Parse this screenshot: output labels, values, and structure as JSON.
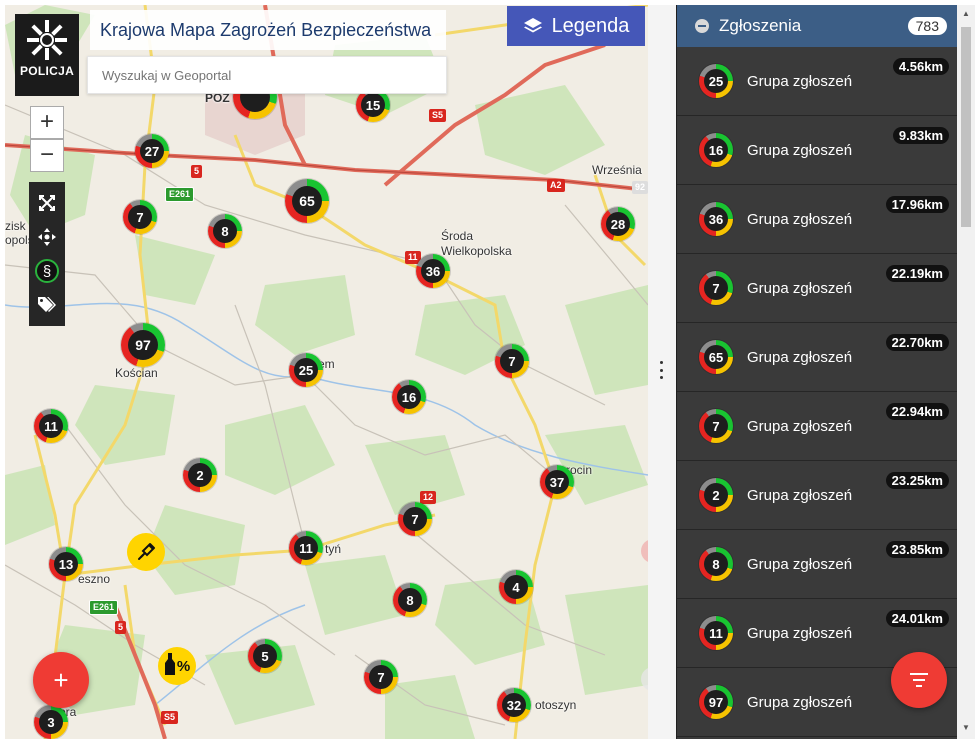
{
  "header": {
    "logo_text": "POLICJA",
    "title_part1": "Krajowa Mapa ",
    "title_part2": "Zagrożeń Bezpieczeństwa",
    "search_placeholder": "Wyszukaj w Geoportal",
    "legend_label": "Legenda"
  },
  "map_controls": {
    "zoom_in": "+",
    "zoom_out": "−",
    "tools": [
      "fullscreen-icon",
      "locate-icon",
      "paragraph-icon",
      "tags-icon"
    ],
    "paragraph_glyph": "§",
    "add_button": "+"
  },
  "places": [
    {
      "id": "poz",
      "label": "POZ"
    },
    {
      "id": "wrzesnia",
      "label": "Września"
    },
    {
      "id": "srem",
      "label": "em"
    },
    {
      "id": "sroda1",
      "label": "Środa"
    },
    {
      "id": "sroda2",
      "label": "Wielkopolska"
    },
    {
      "id": "koscian",
      "label": "Kościan"
    },
    {
      "id": "leszno",
      "label": "eszno"
    },
    {
      "id": "gostyn",
      "label": "tyń"
    },
    {
      "id": "jarocin",
      "label": "rocin"
    },
    {
      "id": "krotoszyn",
      "label": "otoszyn"
    },
    {
      "id": "grodzisk1",
      "label": "zisk"
    },
    {
      "id": "grodzisk2",
      "label": "opolski"
    },
    {
      "id": "gora",
      "label": "ora"
    }
  ],
  "road_labels": [
    "S5",
    "5",
    "E261",
    "11",
    "A2",
    "12",
    "E261",
    "5",
    "S5",
    "92"
  ],
  "clusters": [
    "27",
    "15",
    "65",
    "7",
    "8",
    "28",
    "36",
    "97",
    "25",
    "16",
    "7",
    "11",
    "2",
    "37",
    "7",
    "11",
    "13",
    "8",
    "4",
    "5",
    "7",
    "32",
    "3"
  ],
  "poi": {
    "percent_label": "%"
  },
  "panel": {
    "title": "Zgłoszenia",
    "count": "783",
    "items": [
      {
        "count": "25",
        "label": "Grupa zgłoszeń",
        "distance": "4.56km"
      },
      {
        "count": "16",
        "label": "Grupa zgłoszeń",
        "distance": "9.83km"
      },
      {
        "count": "36",
        "label": "Grupa zgłoszeń",
        "distance": "17.96km"
      },
      {
        "count": "7",
        "label": "Grupa zgłoszeń",
        "distance": "22.19km"
      },
      {
        "count": "65",
        "label": "Grupa zgłoszeń",
        "distance": "22.70km"
      },
      {
        "count": "7",
        "label": "Grupa zgłoszeń",
        "distance": "22.94km"
      },
      {
        "count": "2",
        "label": "Grupa zgłoszeń",
        "distance": "23.25km"
      },
      {
        "count": "8",
        "label": "Grupa zgłoszeń",
        "distance": "23.85km"
      },
      {
        "count": "11",
        "label": "Grupa zgłoszeń",
        "distance": "24.01km"
      },
      {
        "count": "97",
        "label": "Grupa zgłoszeń",
        "distance": ""
      }
    ]
  },
  "colors": {
    "panel_header": "#3c5e86",
    "legend_button": "#4557b8",
    "fab": "#ef3b34",
    "cluster_red": "#e52521",
    "cluster_yellow": "#f6c300",
    "cluster_green": "#19c431",
    "cluster_grey": "#8d8d8d"
  }
}
